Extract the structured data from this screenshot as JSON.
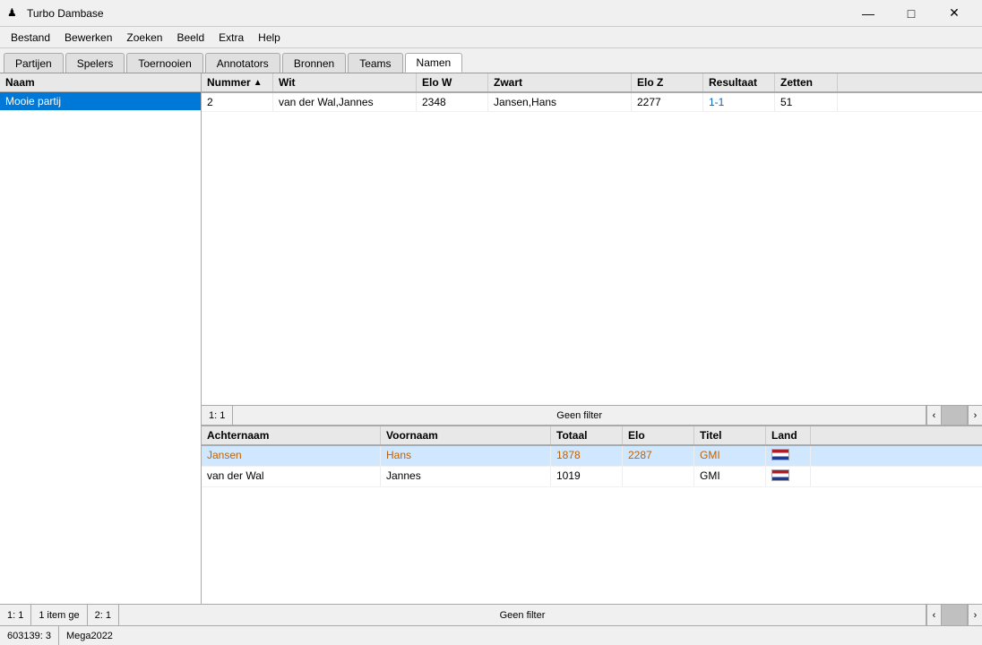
{
  "window": {
    "title": "Turbo Dambase",
    "icon": "♟"
  },
  "titlebar": {
    "minimize": "—",
    "maximize": "□",
    "close": "✕"
  },
  "menubar": {
    "items": [
      "Bestand",
      "Bewerken",
      "Zoeken",
      "Beeld",
      "Extra",
      "Help"
    ]
  },
  "tabs": [
    {
      "label": "Partijen",
      "active": false
    },
    {
      "label": "Spelers",
      "active": false
    },
    {
      "label": "Toernooien",
      "active": false
    },
    {
      "label": "Annotators",
      "active": false
    },
    {
      "label": "Bronnen",
      "active": false
    },
    {
      "label": "Teams",
      "active": false
    },
    {
      "label": "Namen",
      "active": true
    }
  ],
  "left_panel": {
    "header": "Naam",
    "items": [
      {
        "label": "Mooie partij",
        "selected": true
      }
    ]
  },
  "upper_table": {
    "columns": [
      {
        "key": "nummer",
        "label": "Nummer",
        "sortable": true,
        "sort": "asc"
      },
      {
        "key": "wit",
        "label": "Wit",
        "sortable": false
      },
      {
        "key": "elow",
        "label": "Elo W",
        "sortable": false
      },
      {
        "key": "zwart",
        "label": "Zwart",
        "sortable": false
      },
      {
        "key": "eloz",
        "label": "Elo Z",
        "sortable": false
      },
      {
        "key": "resultaat",
        "label": "Resultaat",
        "sortable": false
      },
      {
        "key": "zetten",
        "label": "Zetten",
        "sortable": false
      }
    ],
    "rows": [
      {
        "nummer": "2",
        "wit": "van der Wal,Jannes",
        "elow": "2348",
        "zwart": "Jansen,Hans",
        "eloz": "2277",
        "resultaat": "1-1",
        "zetten": "51"
      }
    ]
  },
  "upper_status": {
    "record": "1: 1",
    "filter": "Geen filter",
    "scroll_left": "‹",
    "scroll_right": "›"
  },
  "lower_table": {
    "columns": [
      {
        "key": "achternaam",
        "label": "Achternaam"
      },
      {
        "key": "voornaam",
        "label": "Voornaam"
      },
      {
        "key": "totaal",
        "label": "Totaal"
      },
      {
        "key": "elo",
        "label": "Elo"
      },
      {
        "key": "titel",
        "label": "Titel"
      },
      {
        "key": "land",
        "label": "Land"
      }
    ],
    "rows": [
      {
        "achternaam": "Jansen",
        "voornaam": "Hans",
        "totaal": "1878",
        "elo": "2287",
        "titel": "GMI",
        "land": "nl",
        "selected": true
      },
      {
        "achternaam": "van der Wal",
        "voornaam": "Jannes",
        "totaal": "1019",
        "elo": "",
        "titel": "GMI",
        "land": "nl",
        "selected": false
      }
    ]
  },
  "bottom_status": {
    "record": "1: 1",
    "items": "1 item ge",
    "record2": "2: 1",
    "filter": "Geen filter",
    "scroll_left": "‹",
    "scroll_right": "›"
  },
  "footer": {
    "db_count": "603139: 3",
    "db_name": "Mega2022"
  }
}
